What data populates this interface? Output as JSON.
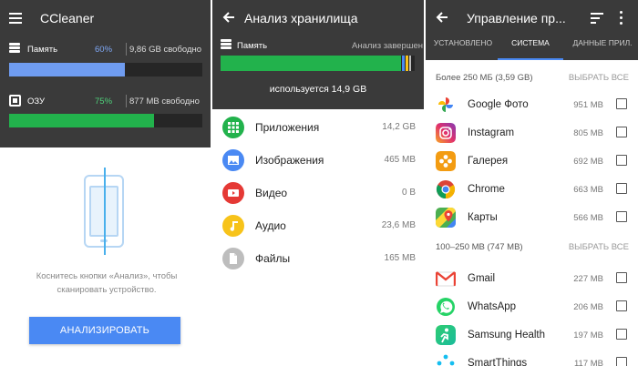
{
  "panel1": {
    "title": "CCleaner",
    "memory": {
      "label": "Память",
      "percent": "60%",
      "free": "9,86 GB свободно",
      "fill": 0.6,
      "color": "#6f9cf0"
    },
    "ram": {
      "label": "ОЗУ",
      "percent": "75%",
      "free": "877 MB свободно",
      "fill": 0.75,
      "color": "#22b24c"
    },
    "hint": "Коснитесь кнопки «Анализ», чтобы сканировать устройство.",
    "analyze_button": "АНАЛИЗИРОВАТЬ"
  },
  "panel2": {
    "title": "Анализ хранилища",
    "memory_label": "Память",
    "status": "Анализ завершен",
    "used": "используется 14,9 GB",
    "categories": [
      {
        "name": "Приложения",
        "size": "14,2 GB",
        "color": "#22b24c",
        "icon": "apps-grid-icon"
      },
      {
        "name": "Изображения",
        "size": "465 MB",
        "color": "#4a89f3",
        "icon": "image-icon"
      },
      {
        "name": "Видео",
        "size": "0 B",
        "color": "#e53935",
        "icon": "video-icon"
      },
      {
        "name": "Аудио",
        "size": "23,6 MB",
        "color": "#f7c31a",
        "icon": "music-note-icon"
      },
      {
        "name": "Файлы",
        "size": "165 MB",
        "color": "#bdbdbd",
        "icon": "file-icon"
      }
    ]
  },
  "panel3": {
    "title": "Управление пр...",
    "tabs": [
      "УСТАНОВЛЕНО",
      "СИСТЕМА",
      "ДАННЫЕ ПРИЛ."
    ],
    "active_tab": 1,
    "section1": {
      "label": "Более 250 MБ (3,59 GB)",
      "select_all": "ВЫБРАТЬ ВСЕ"
    },
    "section2": {
      "label": "100–250 MB (747 MB)",
      "select_all": "ВЫБРАТЬ ВСЕ"
    },
    "apps": [
      {
        "name": "Google Фото",
        "size": "951 MB",
        "icon": "google-photos-icon"
      },
      {
        "name": "Instagram",
        "size": "805 MB",
        "icon": "instagram-icon"
      },
      {
        "name": "Галерея",
        "size": "692 MB",
        "icon": "gallery-icon"
      },
      {
        "name": "Chrome",
        "size": "663 MB",
        "icon": "chrome-icon"
      },
      {
        "name": "Карты",
        "size": "566 MB",
        "icon": "maps-icon"
      },
      {
        "name": "Gmail",
        "size": "227 MB",
        "icon": "gmail-icon"
      },
      {
        "name": "WhatsApp",
        "size": "206 MB",
        "icon": "whatsapp-icon"
      },
      {
        "name": "Samsung Health",
        "size": "197 MB",
        "icon": "samsung-health-icon"
      },
      {
        "name": "SmartThings",
        "size": "117 MB",
        "icon": "smartthings-icon"
      }
    ]
  }
}
